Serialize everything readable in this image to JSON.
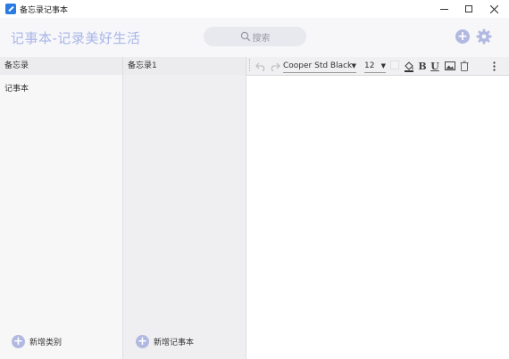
{
  "window": {
    "title": "备忘录记事本"
  },
  "header": {
    "brand": "记事本-记录美好生活",
    "search_label": "搜索"
  },
  "panels": {
    "categories": {
      "header": "备忘录",
      "items": [
        "记事本"
      ],
      "add_label": "新增类别"
    },
    "notes": {
      "header": "备忘录1",
      "add_label": "新增记事本"
    }
  },
  "toolbar": {
    "font_family": "Cooper Std Black",
    "font_size": "12",
    "bold_label": "B",
    "underline_label": "U"
  },
  "colors": {
    "accent": "#b2b9e1",
    "brand_text": "#a9b6e6",
    "app_icon": "#2a7be4"
  },
  "icons": [
    "app-icon",
    "minimize-icon",
    "maximize-icon",
    "close-icon",
    "search-icon",
    "plus-icon",
    "gear-icon",
    "undo-icon",
    "redo-icon",
    "fill-color-icon",
    "image-icon",
    "trash-icon",
    "more-vertical-icon"
  ]
}
